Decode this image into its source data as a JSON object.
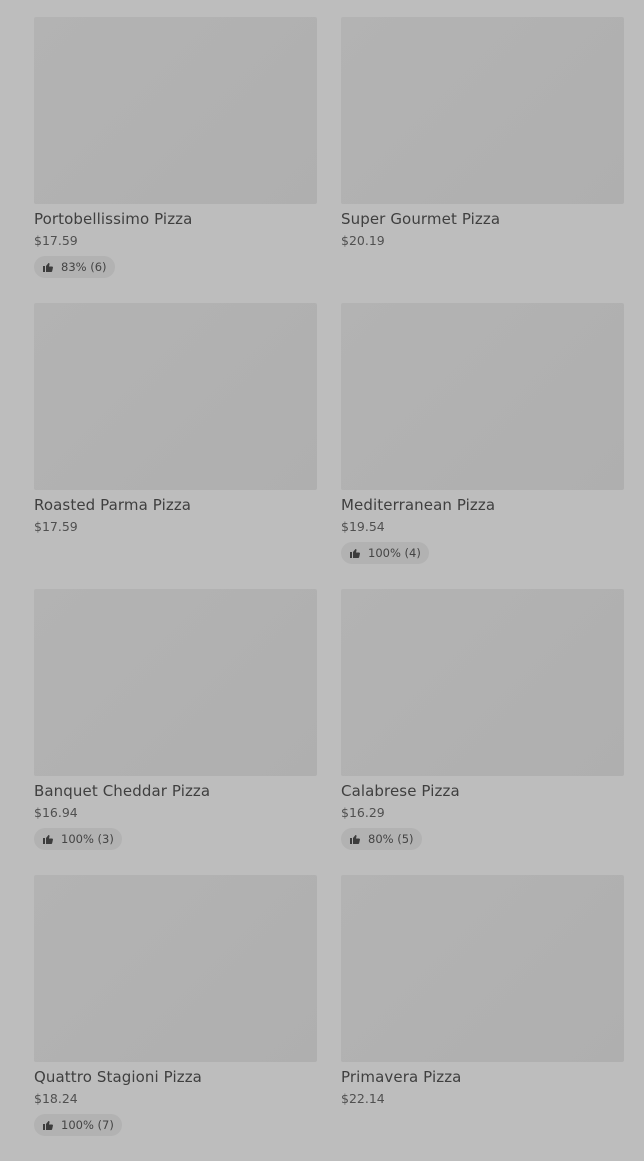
{
  "items": [
    {
      "name": "Portobellissimo Pizza",
      "price": "$17.59",
      "rating": "83% (6)"
    },
    {
      "name": "Super Gourmet Pizza",
      "price": "$20.19",
      "rating": null
    },
    {
      "name": "Roasted Parma Pizza",
      "price": "$17.59",
      "rating": null
    },
    {
      "name": "Mediterranean Pizza",
      "price": "$19.54",
      "rating": "100% (4)"
    },
    {
      "name": "Banquet Cheddar Pizza",
      "price": "$16.94",
      "rating": "100% (3)"
    },
    {
      "name": "Calabrese Pizza",
      "price": "$16.29",
      "rating": "80% (5)"
    },
    {
      "name": "Quattro Stagioni Pizza",
      "price": "$18.24",
      "rating": "100% (7)"
    },
    {
      "name": "Primavera Pizza",
      "price": "$22.14",
      "rating": null
    }
  ],
  "icons": {
    "rating": "thumbs-up-icon"
  },
  "colors": {
    "background": "#bdbdbd",
    "image_placeholder": "#b1b1b1",
    "text": "#3d3d3d"
  }
}
